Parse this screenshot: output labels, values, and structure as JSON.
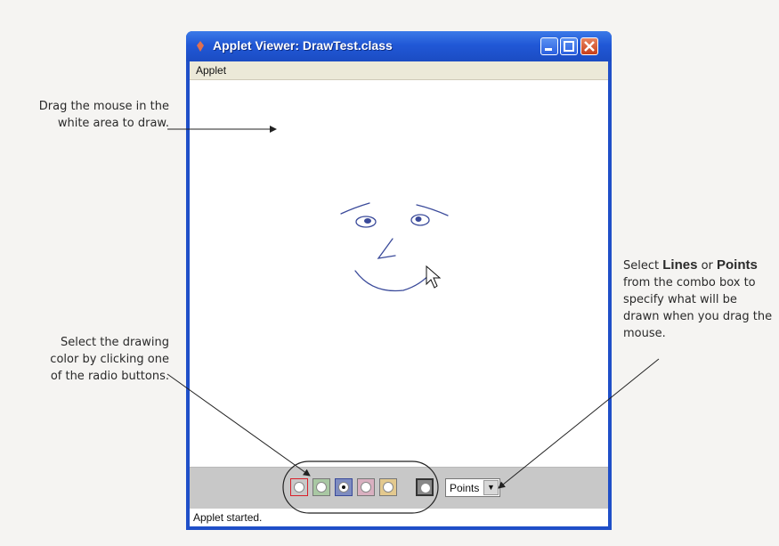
{
  "window": {
    "title": "Applet Viewer: DrawTest.class",
    "menu": [
      "Applet"
    ]
  },
  "controls": {
    "color_options": [
      {
        "color": "#d8202a",
        "selected": false
      },
      {
        "color": "#58a050",
        "selected": false
      },
      {
        "color": "#3a4a9a",
        "selected": true
      },
      {
        "color": "#d07aa0",
        "selected": false
      },
      {
        "color": "#e0b640",
        "selected": false
      },
      {
        "color": "#222222",
        "selected": false
      }
    ],
    "mode_select": {
      "value": "Points",
      "options": [
        "Lines",
        "Points"
      ]
    }
  },
  "status": "Applet started.",
  "callouts": {
    "drag": "Drag the mouse in the white area to draw.",
    "color": "Select the drawing color by clicking one of the radio buttons.",
    "mode": {
      "prefix": "Select ",
      "bold1": "Lines",
      "middle": " or ",
      "bold2": "Points",
      "suffix": " from the combo box to specify what will be drawn when you drag the mouse."
    }
  },
  "drawing": {
    "stroke_color": "#3a4a9a",
    "content": "face-sketch"
  }
}
